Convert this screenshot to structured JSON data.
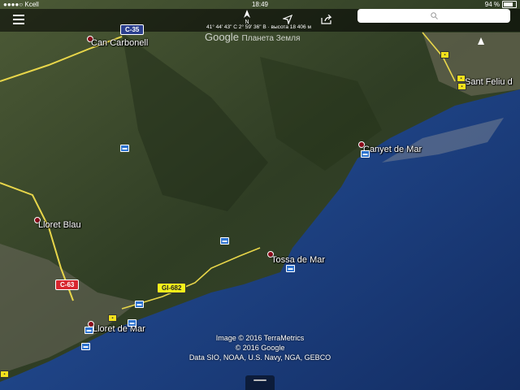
{
  "statusbar": {
    "carrier": "●●●●○ Kcell",
    "time": "18:49",
    "battery_text": "94 %",
    "battery_level": 0.94
  },
  "toolbar": {
    "menu_icon": "menu-icon",
    "compass_label": "N",
    "location_icon": "location-arrow-icon",
    "share_icon": "share-icon",
    "search_placeholder": ""
  },
  "overlay": {
    "coordinates": "41° 44' 43\" С 2° 59' 36\" В · высота 18 406 м",
    "brand_google": "Google",
    "brand_earth": "Планета Земля"
  },
  "places": {
    "can_carbonell": "Can Carbonell",
    "canyet_de_mar": "Canyet de Mar",
    "lloret_blau": "Lloret Blau",
    "tossa_de_mar": "Tossa de Mar",
    "lloret_de_mar": "Lloret de Mar",
    "sant_feliu": "Sant Feliu d"
  },
  "roads": {
    "c35": "C-35",
    "c63": "C-63",
    "gi682": "GI-682"
  },
  "attribution": {
    "line1": "Image © 2016 TerraMetrics",
    "line2": "© 2016 Google",
    "line3": "Data SIO, NOAA, U.S. Navy, NGA, GEBCO"
  },
  "colors": {
    "sea_deep": "#1b3d78",
    "land_dark": "#2c3b22",
    "road_red": "#d8262f",
    "road_yellow": "#f5f21a"
  }
}
